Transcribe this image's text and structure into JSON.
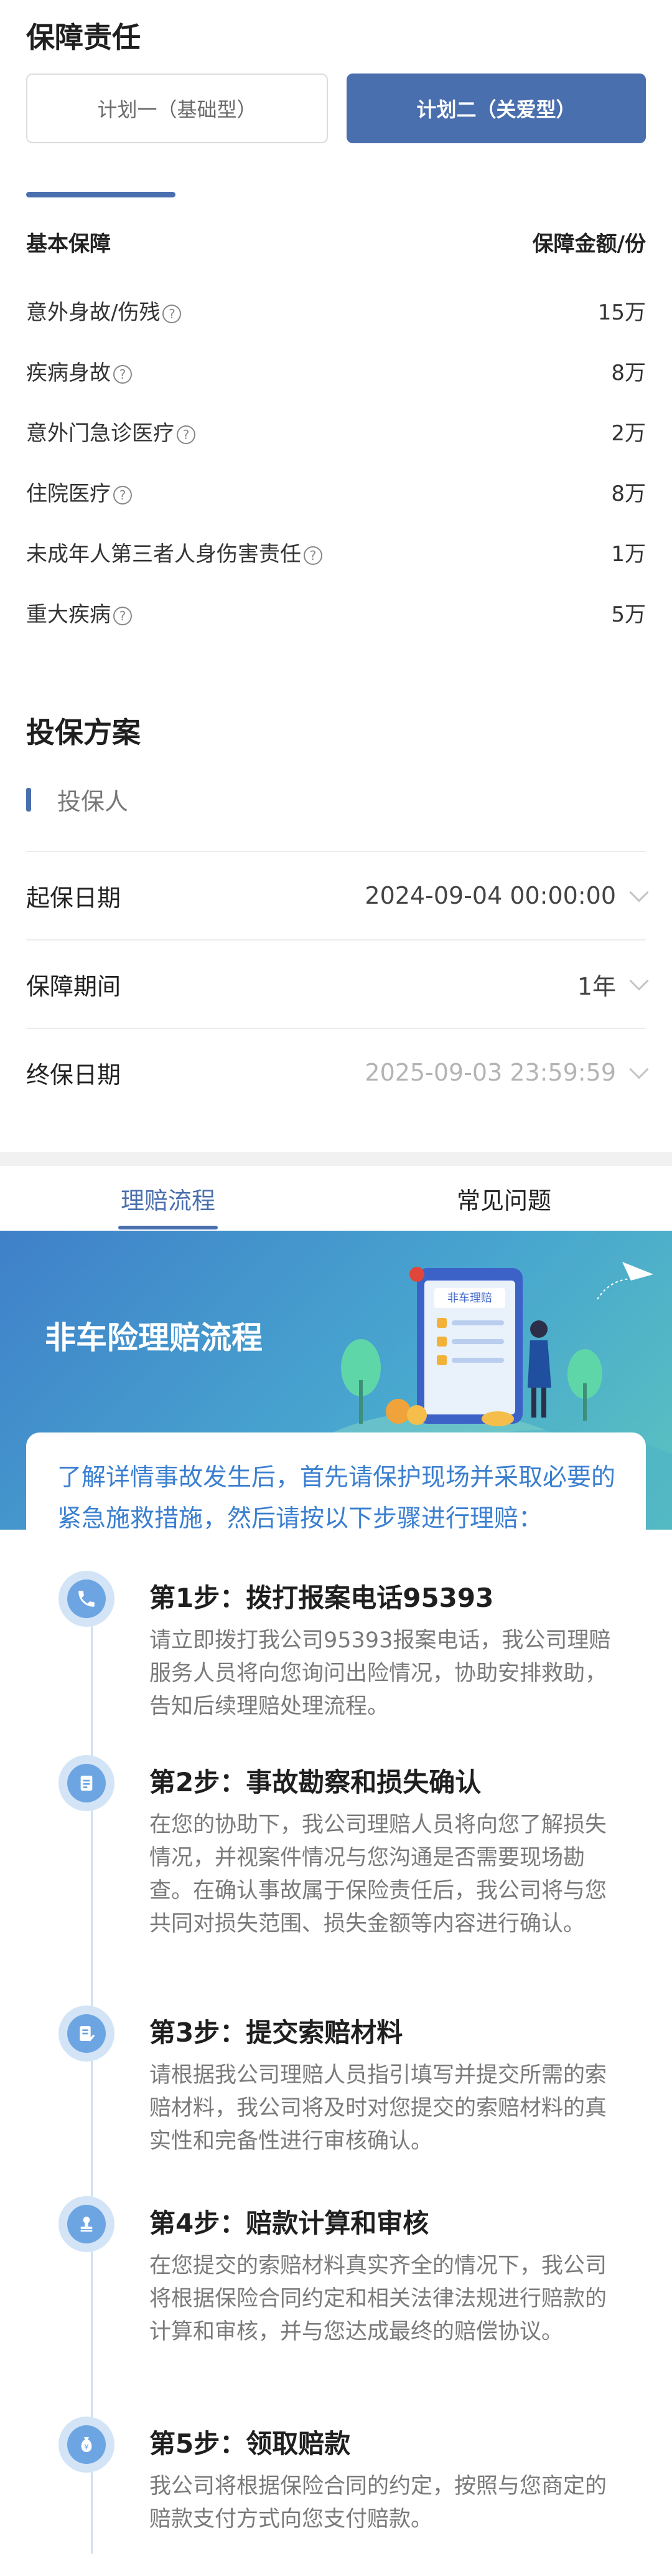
{
  "coverage": {
    "title": "保障责任",
    "plans": [
      {
        "label": "计划一（基础型）",
        "active": false
      },
      {
        "label": "计划二（关爱型）",
        "active": true
      }
    ],
    "header": {
      "left": "基本保障",
      "right": "保障金额/份"
    },
    "items": [
      {
        "name": "意外身故/伤残",
        "amount": "15万"
      },
      {
        "name": "疾病身故",
        "amount": "8万"
      },
      {
        "name": "意外门急诊医疗",
        "amount": "2万"
      },
      {
        "name": "住院医疗",
        "amount": "8万"
      },
      {
        "name": "未成年人第三者人身伤害责任",
        "amount": "1万"
      },
      {
        "name": "重大疾病",
        "amount": "5万"
      }
    ],
    "help_icon": "question-circle-icon"
  },
  "plan": {
    "title": "投保方案",
    "insured_label": "投保人",
    "rows": [
      {
        "label": "起保日期",
        "value": "2024-09-04 00:00:00",
        "disabled": false
      },
      {
        "label": "保障期间",
        "value": "1年",
        "disabled": false
      },
      {
        "label": "终保日期",
        "value": "2025-09-03 23:59:59",
        "disabled": true
      }
    ]
  },
  "tabs": [
    {
      "label": "理赔流程",
      "active": true
    },
    {
      "label": "常见问题",
      "active": false
    }
  ],
  "banner": {
    "title": "非车险理赔流程",
    "phone_screen_label": "非车理赔"
  },
  "process": {
    "intro": "了解详情事故发生后，首先请保护现场并采取必要的紧急施救措施，然后请按以下步骤进行理赔：",
    "steps": [
      {
        "title": "第1步：拨打报案电话95393",
        "icon": "phone-icon",
        "desc": "请立即拨打我公司95393报案电话，我公司理赔服务人员将向您询问出险情况，协助安排救助，告知后续理赔处理流程。"
      },
      {
        "title": "第2步：事故勘察和损失确认",
        "icon": "document-icon",
        "desc": "在您的协助下，我公司理赔人员将向您了解损失情况，并视案件情况与您沟通是否需要现场勘查。在确认事故属于保险责任后，我公司将与您共同对损失范围、损失金额等内容进行确认。"
      },
      {
        "title": "第3步：提交索赔材料",
        "icon": "form-check-icon",
        "desc": "请根据我公司理赔人员指引填写并提交所需的索赔材料，我公司将及时对您提交的索赔材料的真实性和完备性进行审核确认。"
      },
      {
        "title": "第4步：赔款计算和审核",
        "icon": "stamp-icon",
        "desc": "在您提交的索赔材料真实齐全的情况下，我公司将根据保险合同约定和相关法律法规进行赔款的计算和审核，并与您达成最终的赔偿协议。"
      },
      {
        "title": "第5步：领取赔款",
        "icon": "money-bag-icon",
        "desc": "我公司将根据保险合同的约定，按照与您商定的赔款支付方式向您支付赔款。"
      }
    ]
  },
  "colors": {
    "primary": "#4a6fae",
    "link": "#3b7fd0",
    "step_icon": "#6da5e2"
  }
}
